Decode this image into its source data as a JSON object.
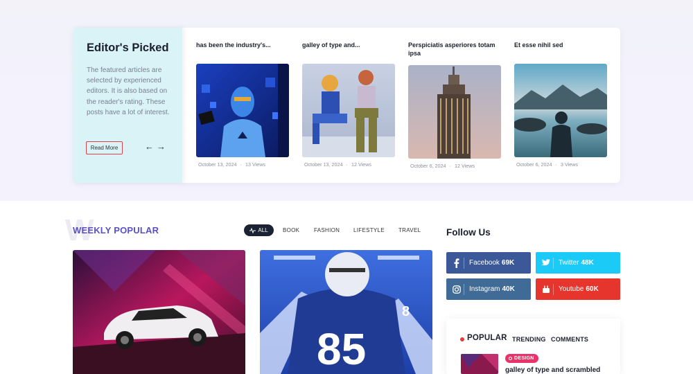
{
  "editors": {
    "title": "Editor's Picked",
    "description": "The featured articles are selected by experienced editors. It is also based on the reader's rating. These posts have a lot of interest.",
    "read_more": "Read More",
    "prev_arrow": "←",
    "next_arrow": "→",
    "posts": [
      {
        "title": "has been the industry's...",
        "date": "October 13, 2024",
        "views": "13 Views",
        "image": "hoodie-figure-blue-cubes"
      },
      {
        "title": "galley of type and...",
        "date": "October 13, 2024",
        "views": "12 Views",
        "image": "two-toy-figures-sitting"
      },
      {
        "title": "Perspiciatis asperiores totam ipsa",
        "date": "October 6, 2024",
        "views": "12 Views",
        "image": "skyscraper-dusk"
      },
      {
        "title": "Et esse nihil sed",
        "date": "October 6, 2024",
        "views": "3 Views",
        "image": "person-lake-mountains"
      }
    ],
    "dot": "·"
  },
  "weekly": {
    "bg_letter": "W",
    "title": "WEEKLY POPULAR",
    "filters": {
      "all": "ALL",
      "book": "BOOK",
      "fashion": "FASHION",
      "lifestyle": "LIFESTYLE",
      "travel": "TRAVEL"
    },
    "images": [
      "white-suv-neon-garage",
      "football-player-blue-jersey-85"
    ]
  },
  "follow": {
    "title": "Follow Us",
    "facebook": {
      "label": "Facebook",
      "count": "69K",
      "color": "#3b5998"
    },
    "twitter": {
      "label": "Twitter",
      "count": "48K",
      "color": "#1ccaf7"
    },
    "instagram": {
      "label": "Instagram",
      "count": "40K",
      "color": "#3f6b96"
    },
    "youtube": {
      "label": "Youtube",
      "count": "60K",
      "color": "#e5352c"
    }
  },
  "popular": {
    "tabs": {
      "popular": "POPULAR",
      "trending": "TRENDING",
      "comments": "COMMENTS"
    },
    "item": {
      "badge": "DESIGN",
      "title": "galley of type and scrambled",
      "image": "neon-garage-thumb"
    }
  },
  "colors": {
    "accent": "#5a4fc7",
    "badge": "#e8336a",
    "card_bg": "#d9f3f7"
  }
}
